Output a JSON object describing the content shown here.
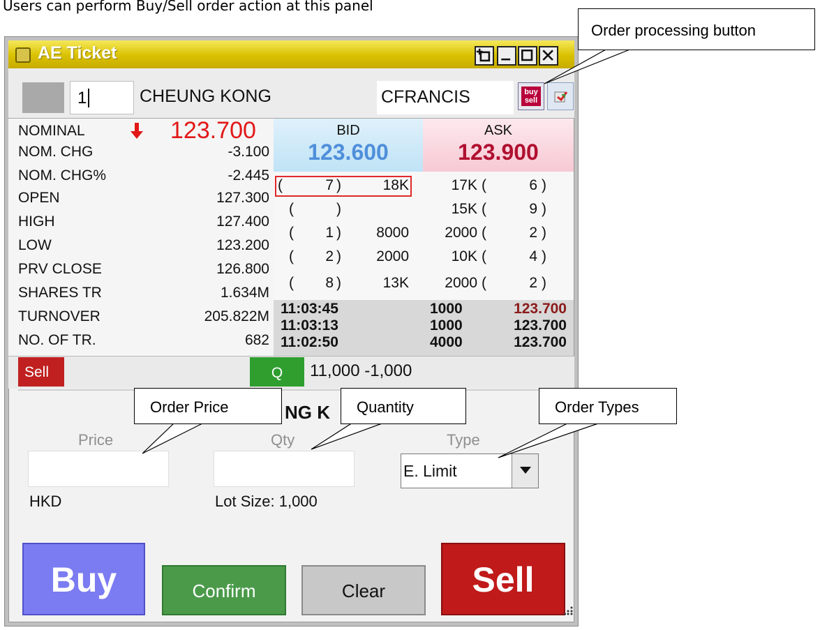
{
  "caption": "Users can perform Buy/Sell order action at this panel",
  "window": {
    "title": "AE Ticket",
    "colors": {
      "titlebar": "#d9c000",
      "bid_bg": "#bfe3f6",
      "ask_bg": "#f7c9d4",
      "buy": "#7b7bf2",
      "sell": "#c01a1a",
      "confirm": "#4a9a4a"
    }
  },
  "header": {
    "stock_code": "1",
    "stock_name": "CHEUNG KONG",
    "account": "CFRANCIS",
    "buy_sell_button": "buy sell",
    "buy_sell_word1": "buy",
    "buy_sell_word2": "sell"
  },
  "stats": [
    {
      "label": "NOMINAL",
      "value": "123.700"
    },
    {
      "label": "NOM. CHG",
      "value": "-3.100"
    },
    {
      "label": "NOM. CHG%",
      "value": "-2.445"
    },
    {
      "label": "OPEN",
      "value": "127.300"
    },
    {
      "label": "HIGH",
      "value": "127.400"
    },
    {
      "label": "LOW",
      "value": "123.200"
    },
    {
      "label": "PRV CLOSE",
      "value": "126.800"
    },
    {
      "label": "SHARES TR",
      "value": "1.634M"
    },
    {
      "label": "TURNOVER",
      "value": "205.822M"
    },
    {
      "label": "NO. OF TR.",
      "value": "682"
    }
  ],
  "quote": {
    "bid_label": "BID",
    "bid_price": "123.600",
    "ask_label": "ASK",
    "ask_price": "123.900"
  },
  "depth": [
    {
      "bid_q": "(",
      "bid_n": "7",
      "bid_c": ")",
      "bid_vol": "18K",
      "ask_vol": "17K",
      "ask_o": "(",
      "ask_n": "6",
      "ask_c": ")"
    },
    {
      "bid_q": "(",
      "bid_n": "",
      "bid_c": ")",
      "bid_vol": "",
      "ask_vol": "15K",
      "ask_o": "(",
      "ask_n": "9",
      "ask_c": ")"
    },
    {
      "bid_q": "(",
      "bid_n": "1",
      "bid_c": ")",
      "bid_vol": "8000",
      "ask_vol": "2000",
      "ask_o": "(",
      "ask_n": "2",
      "ask_c": ")"
    },
    {
      "bid_q": "(",
      "bid_n": "2",
      "bid_c": ")",
      "bid_vol": "2000",
      "ask_vol": "10K",
      "ask_o": "(",
      "ask_n": "4",
      "ask_c": ")"
    },
    {
      "bid_q": "(",
      "bid_n": "8",
      "bid_c": ")",
      "bid_vol": "13K",
      "ask_vol": "2000",
      "ask_o": "(",
      "ask_n": "2",
      "ask_c": ")"
    }
  ],
  "trades": [
    {
      "time": "11:03:45",
      "qty": "1000",
      "price": "123.700"
    },
    {
      "time": "11:03:13",
      "qty": "1000",
      "price": "123.700"
    },
    {
      "time": "11:02:50",
      "qty": "4000",
      "price": "123.700"
    }
  ],
  "order_bar": {
    "sell_tag": "Sell",
    "q_tag": "Q",
    "qty_info": "11,000  -1,000",
    "name_fragment": "NG K"
  },
  "form": {
    "price_label": "Price",
    "price_value": "",
    "currency": "HKD",
    "qty_label": "Qty",
    "qty_value": "",
    "lot_size": "Lot Size:  1,000",
    "type_label": "Type",
    "type_value": "E. Limit"
  },
  "buttons": {
    "buy": "Buy",
    "confirm": "Confirm",
    "clear": "Clear",
    "sell": "Sell"
  },
  "callouts": {
    "order_processing": "Order processing button",
    "order_price": "Order Price",
    "quantity": "Quantity",
    "order_types": "Order Types"
  }
}
